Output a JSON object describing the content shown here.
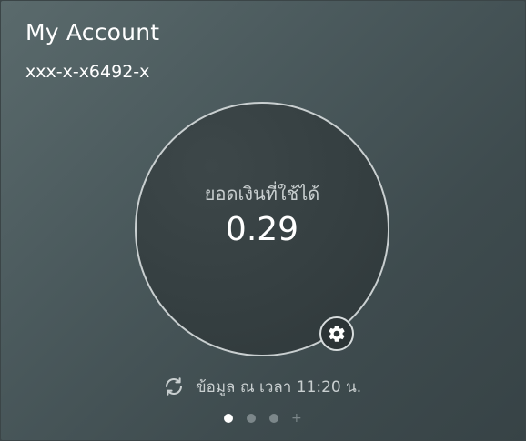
{
  "account": {
    "title": "My Account",
    "number": "xxx-x-x6492-x"
  },
  "balance": {
    "label": "ยอดเงินที่ใช้ได้",
    "value": "0.29"
  },
  "update": {
    "text": "ข้อมูล ณ เวลา 11:20 น."
  },
  "pager": {
    "pages": 3,
    "active_index": 0,
    "add_symbol": "+"
  },
  "icons": {
    "settings": "gear-icon",
    "refresh": "refresh-icon"
  },
  "colors": {
    "background": "#4b5a5d",
    "circle_border": "#c9cfd0",
    "text_primary": "#ffffff",
    "text_secondary": "#c9cfd0",
    "dot_active": "#ffffff",
    "dot_inactive": "#7c878a"
  }
}
